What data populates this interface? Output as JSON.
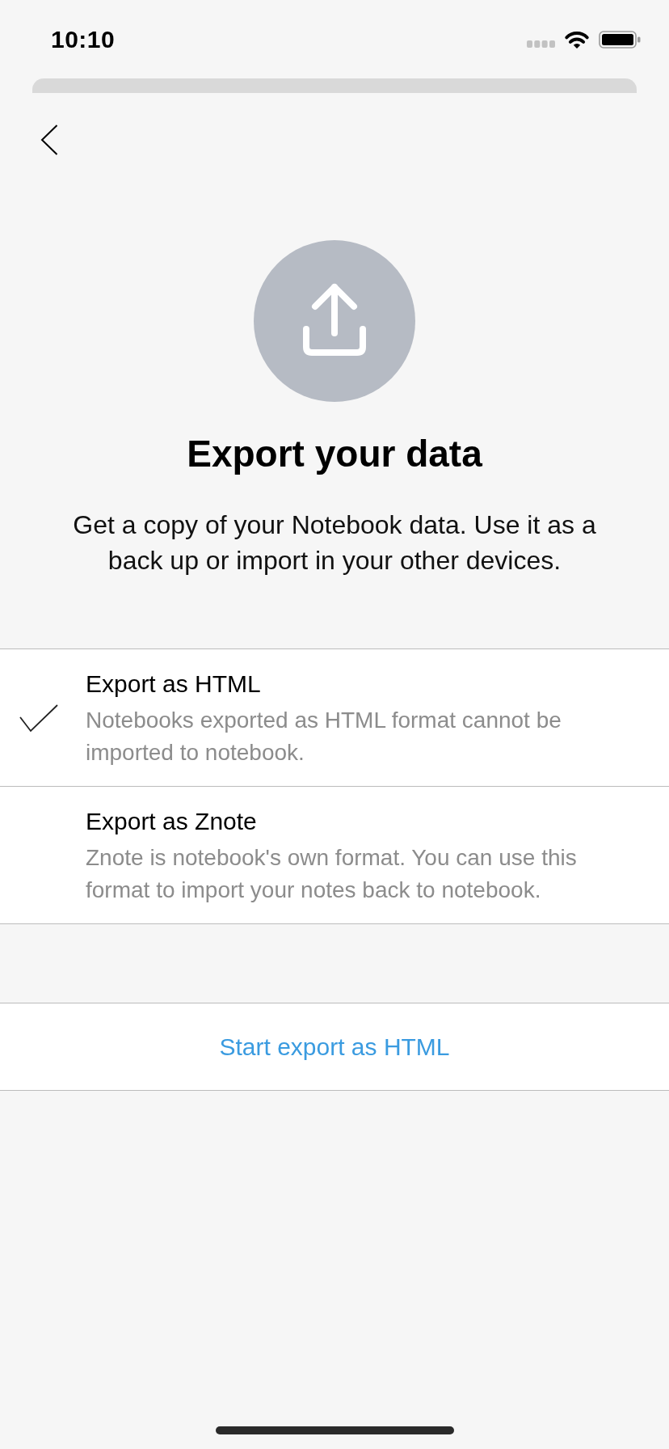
{
  "status_bar": {
    "time": "10:10"
  },
  "header": {
    "title": "Export your data",
    "description": "Get a copy of your Notebook data. Use it as a back up or import in your other devices."
  },
  "options": [
    {
      "title": "Export as HTML",
      "description": "Notebooks exported as HTML format cannot be imported to notebook.",
      "selected": true
    },
    {
      "title": "Export as Znote",
      "description": "Znote is notebook's own format. You can use this format to import your notes back to notebook.",
      "selected": false
    }
  ],
  "action_button": {
    "label": "Start export as HTML"
  }
}
